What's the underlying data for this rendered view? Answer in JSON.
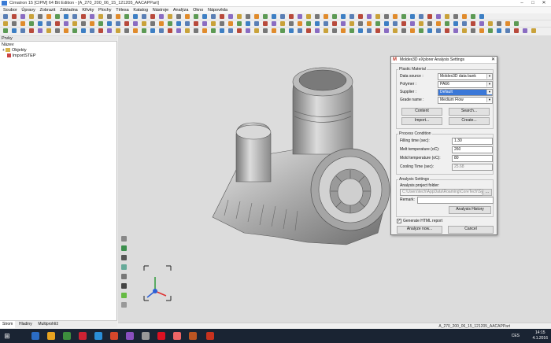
{
  "window": {
    "title": "Cimatron 15 [CIPM] 64 Bit Edition - [A_270_200_06_15_121205_AACAPPart]",
    "controls": [
      "–",
      "□",
      "✕"
    ]
  },
  "menu": [
    "Soubor",
    "Úpravy",
    "Zobrazit",
    "Základna",
    "Křivky",
    "Plochy",
    "Tělesa",
    "Katalog",
    "Nástroje",
    "Analýza",
    "Okno",
    "Nápověda"
  ],
  "left_panel": {
    "header": "Prvky",
    "column_title": "Název",
    "tree": [
      {
        "label": "Objekty",
        "icon": "folder-icon"
      },
      {
        "label": "ImportSTEP",
        "icon": "step-import-icon"
      }
    ],
    "tabs": [
      "Strom",
      "Hladiny",
      "Multiprohlíž"
    ]
  },
  "statusbar": {
    "text": "A_270_200_06_15_121205_AACAPPart"
  },
  "taskbar": {
    "clock_time": "14:15",
    "clock_date": "4.1.2016",
    "lang": "CES"
  },
  "dialog": {
    "title": "Moldex3D eXplorer Analysis Settings",
    "close": "✕",
    "plastic_material": {
      "title": "Plastic Material",
      "data_source_label": "Data source :",
      "data_source_value": "Moldex3D data bank",
      "polymer_label": "Polymer :",
      "polymer_value": "PA66",
      "supplier_label": "Supplier :",
      "supplier_value": "Default",
      "grade_label": "Grade name :",
      "grade_value": "Medium Flow",
      "content_button": "Content",
      "search_button": "Search...",
      "import_button": "Import...",
      "create_button": "Create..."
    },
    "process": {
      "title": "Process Condition",
      "filling_label": "Filling time (sec):",
      "filling_value": "1.30",
      "melt_label": "Melt temperature (oC):",
      "melt_value": "260",
      "mold_label": "Mold temperature (oC):",
      "mold_value": "80",
      "cooling_label": "Cooling Time (sec):",
      "cooling_value": "25.68"
    },
    "analysis": {
      "title": "Analysis Settings",
      "folder_label": "Analysis project folder:",
      "folder_value": "C:\\Users\\tech\\AppData\\Roaming\\CoreTech\\Sys",
      "browse": "...",
      "remark_label": "Remark:",
      "remark_value": "",
      "history_button": "Analysis History"
    },
    "generate_html_label": "Generate HTML report",
    "generate_html_checked": true,
    "analyze_button": "Analyze now...",
    "cancel_button": "Cancel"
  }
}
